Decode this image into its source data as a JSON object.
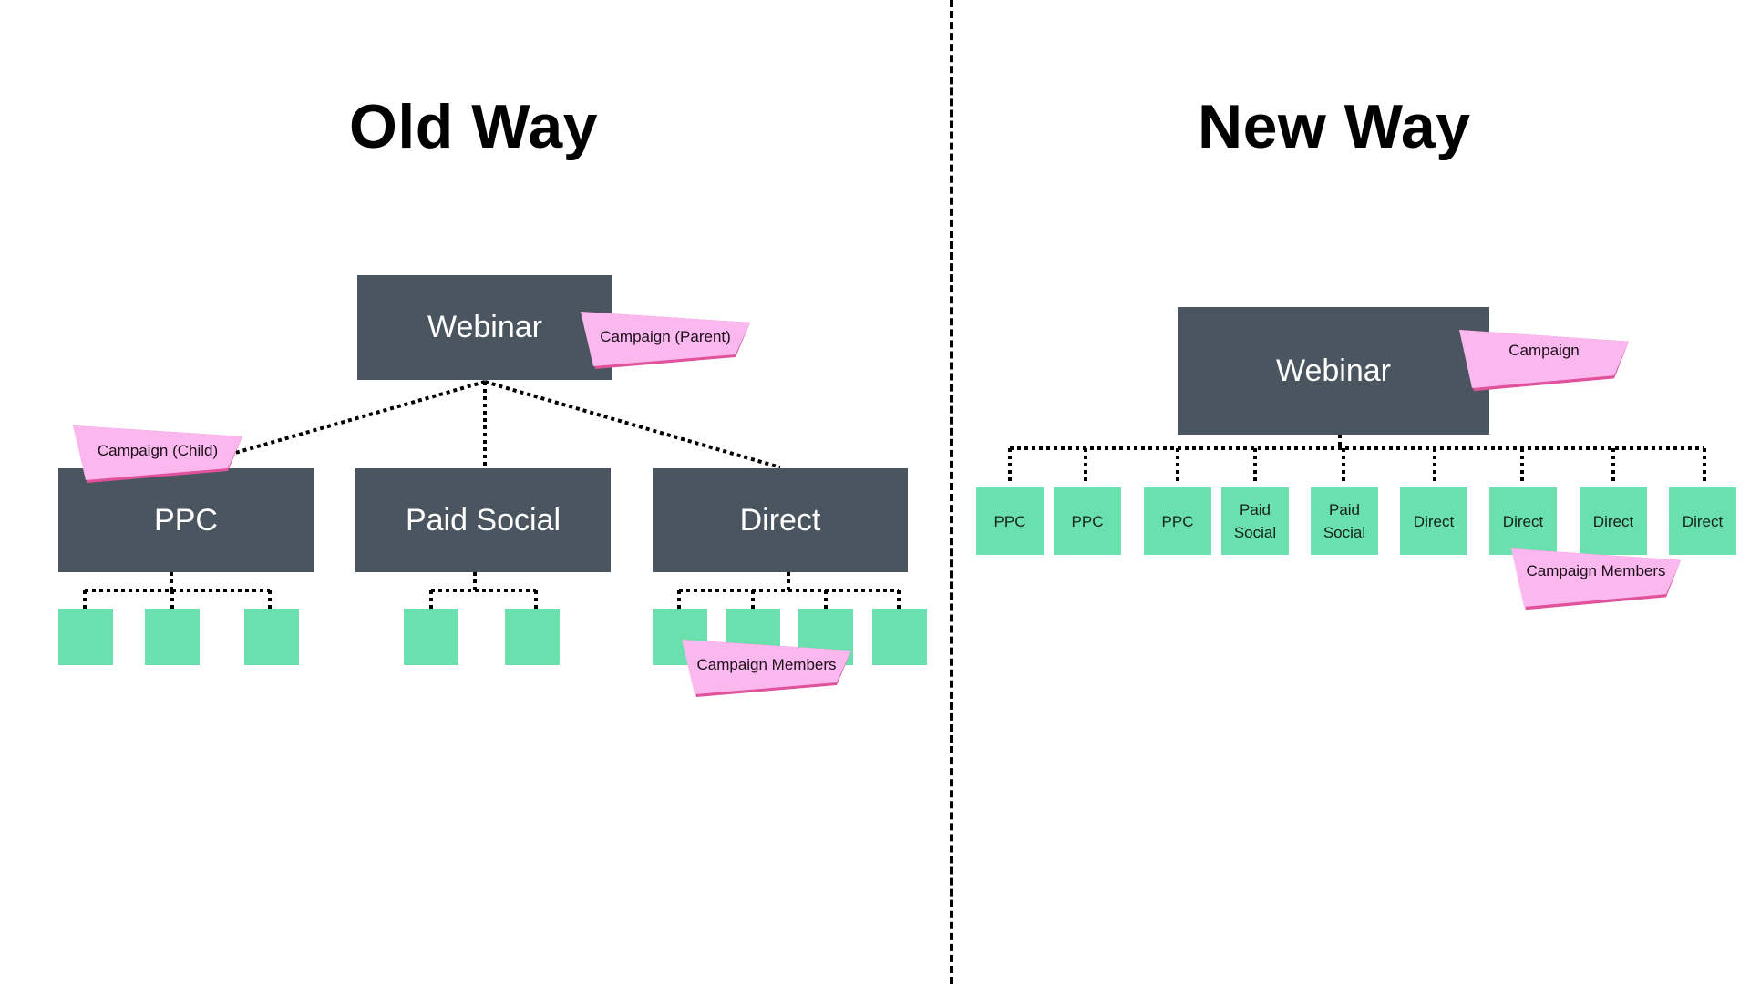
{
  "old_way": {
    "title": "Old Way",
    "root": {
      "label": "Webinar"
    },
    "root_tag": "Campaign (Parent)",
    "child_tag": "Campaign (Child)",
    "children": [
      {
        "label": "PPC",
        "leaf_count": 3
      },
      {
        "label": "Paid Social",
        "leaf_count": 2
      },
      {
        "label": "Direct",
        "leaf_count": 4
      }
    ],
    "members_tag": "Campaign Members"
  },
  "new_way": {
    "title": "New Way",
    "root": {
      "label": "Webinar"
    },
    "root_tag": "Campaign",
    "leaves": [
      {
        "line1": "PPC",
        "line2": ""
      },
      {
        "line1": "PPC",
        "line2": ""
      },
      {
        "line1": "PPC",
        "line2": ""
      },
      {
        "line1": "Paid",
        "line2": "Social"
      },
      {
        "line1": "Paid",
        "line2": "Social"
      },
      {
        "line1": "Direct",
        "line2": ""
      },
      {
        "line1": "Direct",
        "line2": ""
      },
      {
        "line1": "Direct",
        "line2": ""
      },
      {
        "line1": "Direct",
        "line2": ""
      }
    ],
    "members_tag": "Campaign Members"
  },
  "colors": {
    "node_dark": "#4a5560",
    "leaf_green": "#6ae0ae",
    "tag_pink": "#fbb8ee",
    "tag_edge": "#e0529c"
  }
}
